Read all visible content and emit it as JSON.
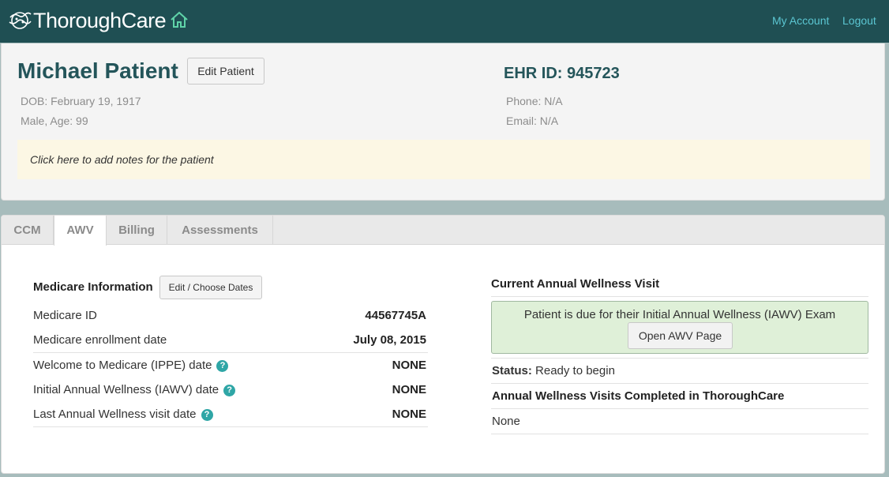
{
  "nav": {
    "brand": "ThoroughCare",
    "home_icon": "home-icon",
    "my_account": "My Account",
    "logout": "Logout"
  },
  "patient": {
    "name": "Michael Patient",
    "edit_button": "Edit Patient",
    "ehr_id": "EHR ID: 945723",
    "dob": "DOB: February 19, 1917",
    "sex_age": "Male, Age: 99",
    "phone": "Phone: N/A",
    "email": "Email: N/A",
    "notes_placeholder": "Click here to add notes for the patient"
  },
  "tabs": [
    {
      "label": "CCM",
      "active": false
    },
    {
      "label": "AWV",
      "active": true
    },
    {
      "label": "Billing",
      "active": false
    },
    {
      "label": "Assessments",
      "active": false
    }
  ],
  "medicare": {
    "title": "Medicare Information",
    "edit_dates_button": "Edit / Choose Dates",
    "rows": [
      {
        "label": "Medicare ID",
        "value": "44567745A",
        "help": false
      },
      {
        "label": "Medicare enrollment date",
        "value": "July 08, 2015",
        "help": false
      },
      {
        "label": "Welcome to Medicare (IPPE) date",
        "value": "NONE",
        "help": true
      },
      {
        "label": "Initial Annual Wellness (IAWV) date",
        "value": "NONE",
        "help": true
      },
      {
        "label": "Last Annual Wellness visit date",
        "value": "NONE",
        "help": true
      }
    ]
  },
  "awv": {
    "title": "Current Annual Wellness Visit",
    "due_message": "Patient is due for their Initial Annual Wellness (IAWV) Exam",
    "open_button": "Open AWV Page",
    "status_label": "Status:",
    "status_value": "Ready to begin",
    "completed_title": "Annual Wellness Visits Completed in ThoroughCare",
    "completed_value": "None"
  },
  "colors": {
    "nav_bg": "#1f4f53",
    "nav_link": "#5bc6d2",
    "name_color": "#24555a",
    "notes_bg": "#fcf7e4",
    "due_bg": "#dff0d8",
    "help_icon": "#2fa6a6"
  }
}
